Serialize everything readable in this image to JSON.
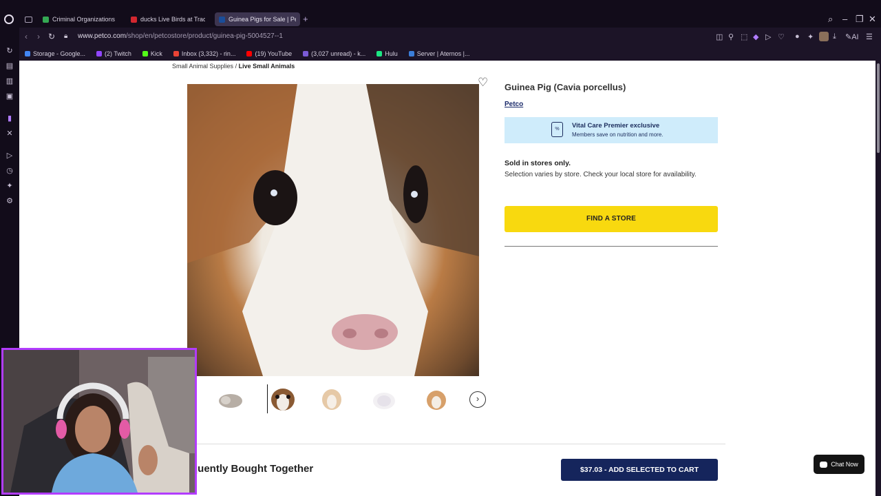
{
  "tabs": [
    {
      "title": "Criminal Organizations - G",
      "fav_color": "#34a853"
    },
    {
      "title": "ducks Live Birds at Tractor",
      "fav_color": "#d3272f"
    },
    {
      "title": "Guinea Pigs for Sale | Pet",
      "fav_color": "#1a4d99",
      "active": true
    }
  ],
  "toolbar": {
    "url_host": "www.petco.com",
    "url_path": "/shop/en/petcostore/product/guinea-pig-5004527--1",
    "ai_label": "AI"
  },
  "bookmarks": [
    {
      "label": "Storage - Google...",
      "color": "#4285f4"
    },
    {
      "label": "(2) Twitch",
      "color": "#9146ff"
    },
    {
      "label": "Kick",
      "color": "#53fc18"
    },
    {
      "label": "Inbox (3,332) - rin...",
      "color": "#ea4335"
    },
    {
      "label": "(19) YouTube",
      "color": "#ff0000"
    },
    {
      "label": "(3,027 unread) - k...",
      "color": "#7b5bd6"
    },
    {
      "label": "Hulu",
      "color": "#1ce783"
    },
    {
      "label": "Server | Aternos |...",
      "color": "#3b7dd8"
    }
  ],
  "breadcrumb": {
    "parent": "Small Animal Supplies",
    "separator": "/",
    "current": "Live Small Animals"
  },
  "product": {
    "title": "Guinea Pig (Cavia porcellus)",
    "brand": "Petco",
    "promo_title": "Vital Care Premier exclusive",
    "promo_subtitle": "Members save on nutrition and more.",
    "promo_icon_text": "%",
    "availability_title": "Sold in stores only.",
    "availability_text": "Selection varies by store. Check your local store for availability.",
    "find_store_label": "FIND A STORE"
  },
  "thumbnails": {
    "count": 5,
    "selected_index": 1
  },
  "frequently_bought": {
    "title": "quently Bought Together",
    "add_button": "$37.03 - ADD SELECTED TO CART"
  },
  "chat": {
    "label": "Chat Now"
  },
  "colors": {
    "accent_yellow": "#f8d90f",
    "navy": "#15255c",
    "promo_bg": "#cfecfb",
    "webcam_border": "#b23cff"
  }
}
